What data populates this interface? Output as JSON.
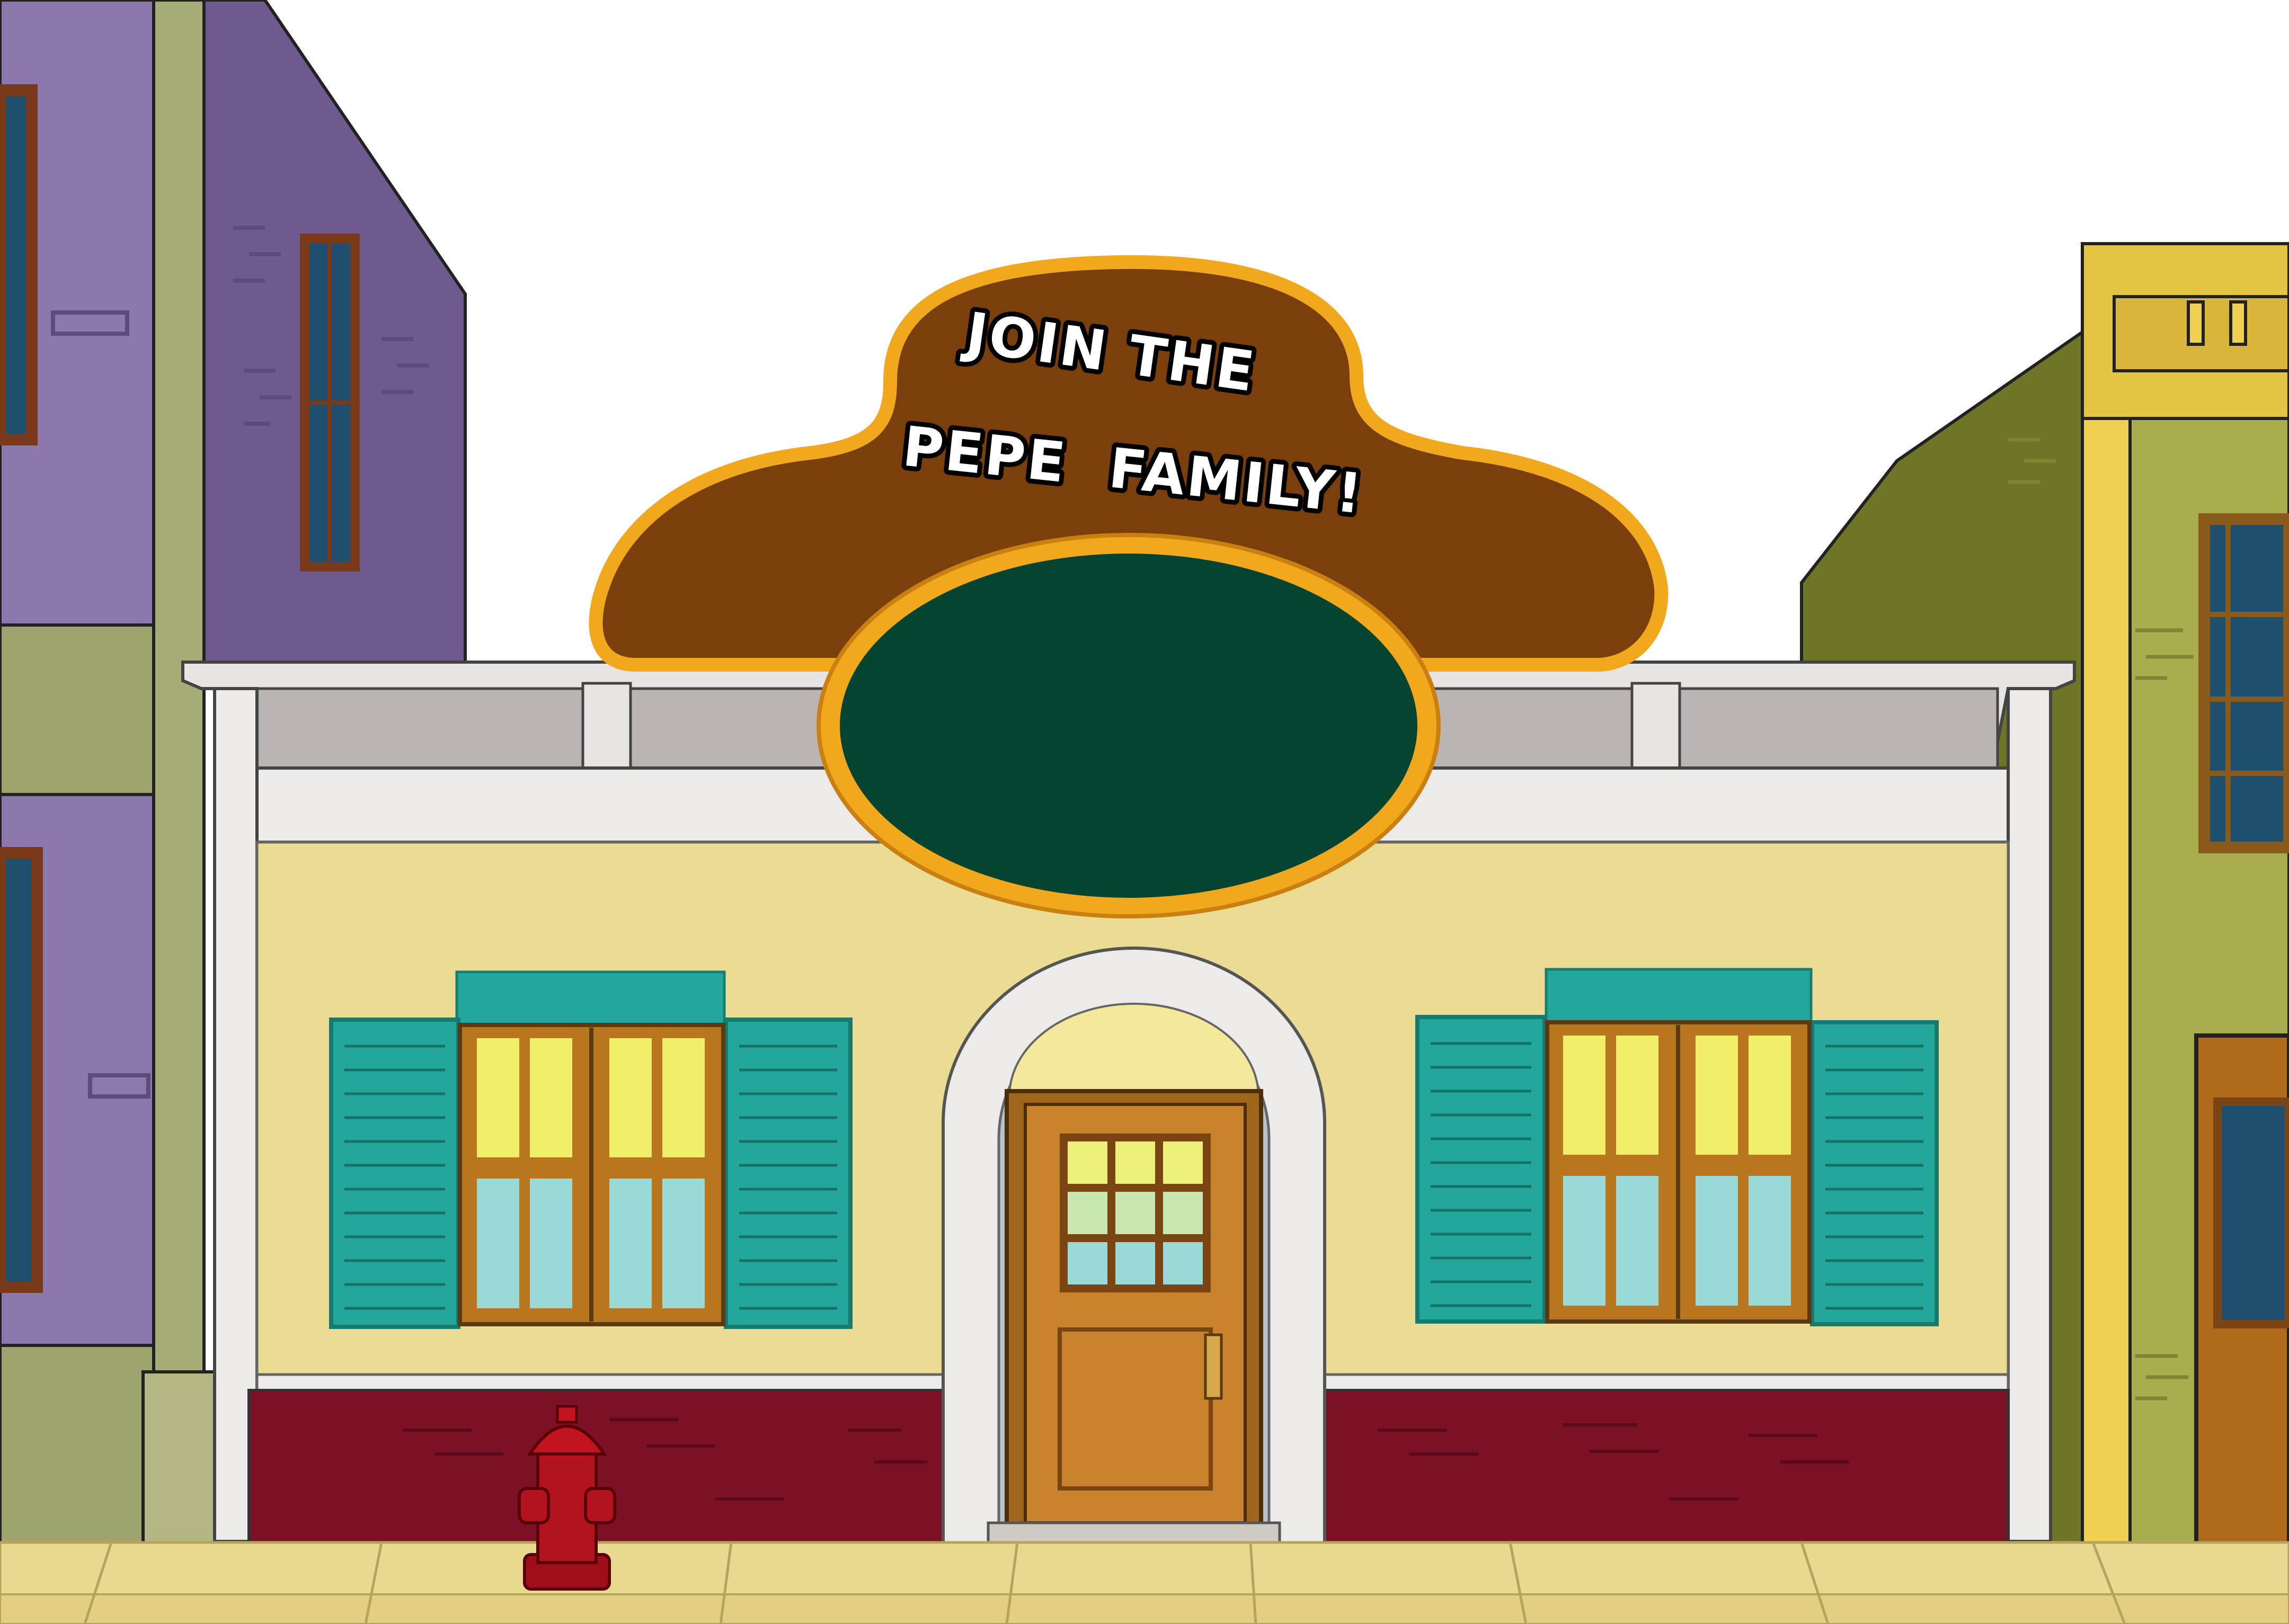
{
  "sign": {
    "line1": "JOIN THE",
    "line2": "PEPE  FAMILY!"
  },
  "colors": {
    "sky": "#ffffff",
    "sign_brown": "#7a3f0a",
    "sign_gold": "#f2a81d",
    "plaque_green": "#054431",
    "shop_wall": "#eadd93",
    "shop_base": "#7c1024",
    "shutters": "#23a79a",
    "door": "#c8832c",
    "sidewalk": "#e9d98f",
    "left_building": "#8c78ac",
    "right_building": "#a8ae4e"
  },
  "icons": {
    "hydrant": "fire-hydrant-icon"
  }
}
